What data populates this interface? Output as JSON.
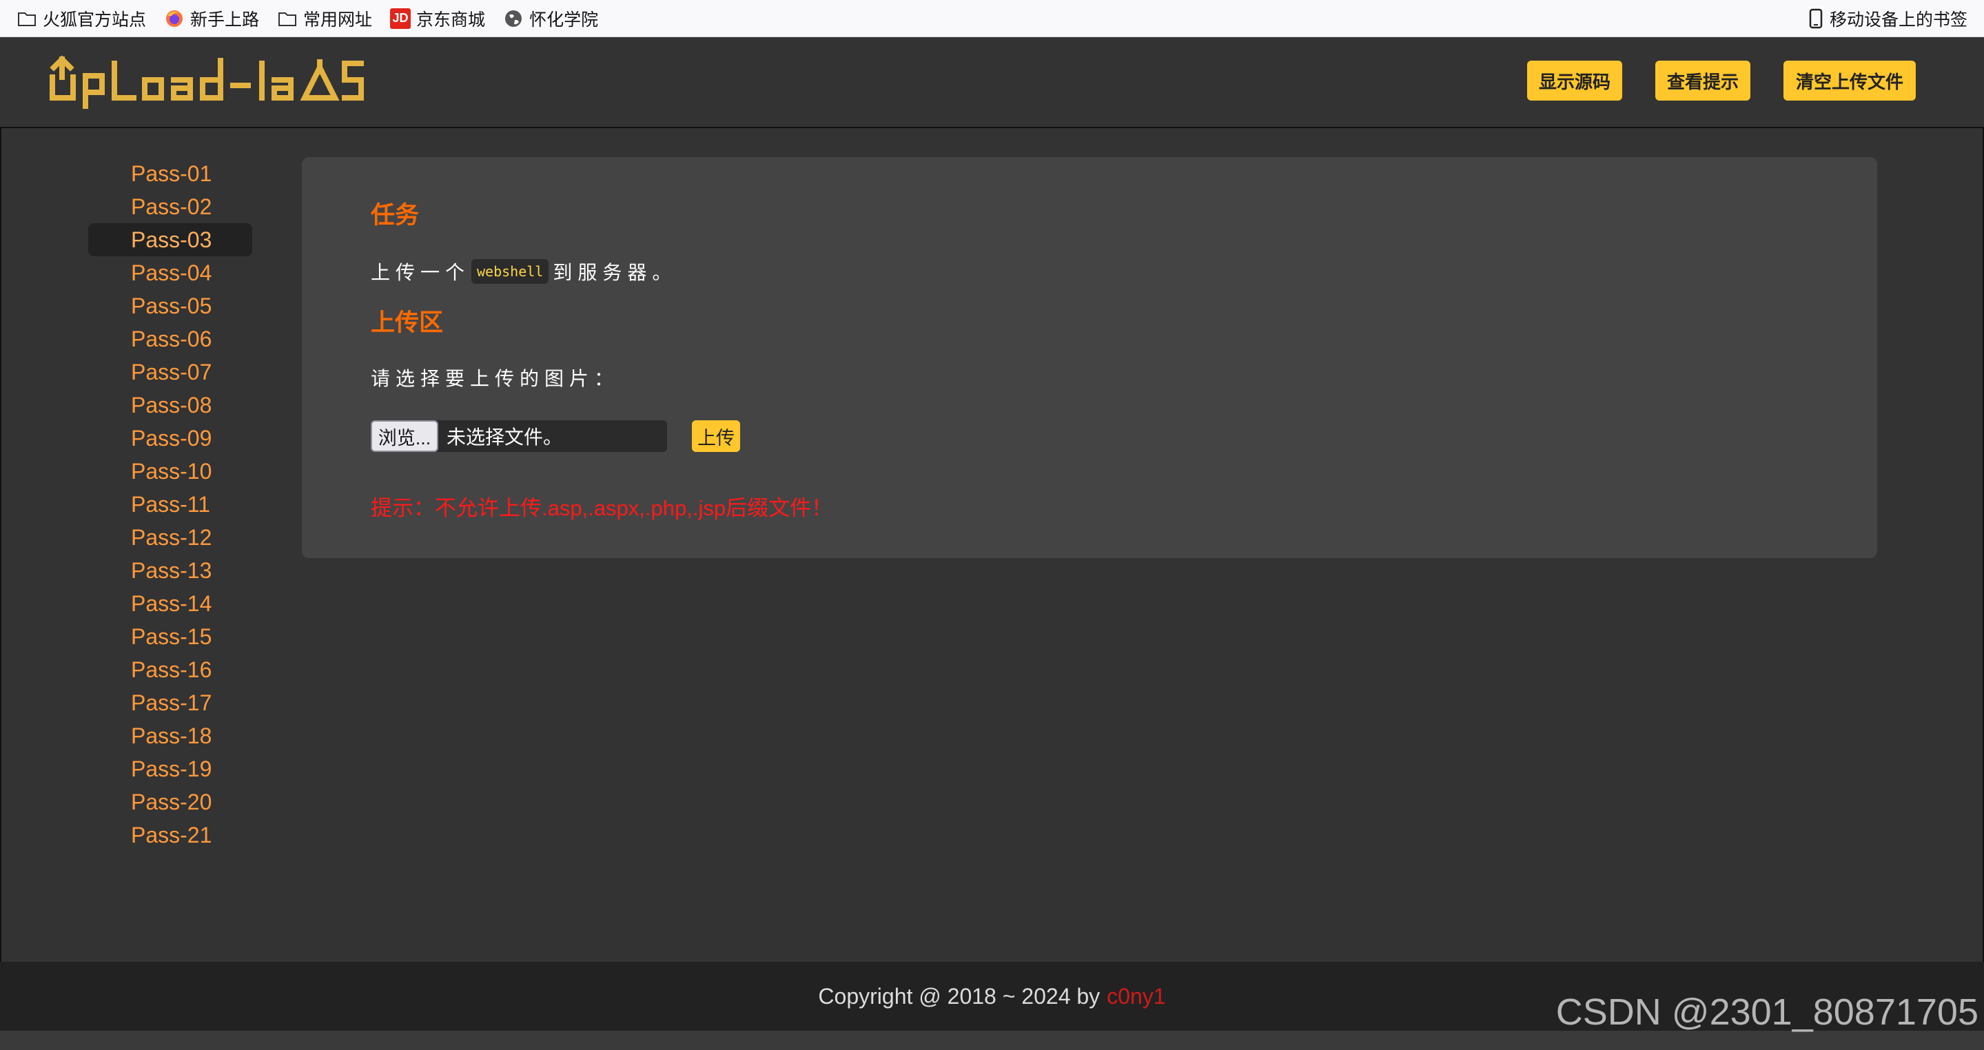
{
  "bookmarks": {
    "items": [
      {
        "label": "火狐官方站点",
        "icon": "folder-icon"
      },
      {
        "label": "新手上路",
        "icon": "firefox-icon"
      },
      {
        "label": "常用网址",
        "icon": "folder-icon"
      },
      {
        "label": "京东商城",
        "icon": "jd-icon"
      },
      {
        "label": "怀化学院",
        "icon": "globe-icon"
      }
    ],
    "right": {
      "label": "移动设备上的书签",
      "icon": "mobile-icon"
    },
    "jd_badge": "JD"
  },
  "header": {
    "logo_text": "Upload-labs",
    "buttons": {
      "show_source": "显示源码",
      "view_hint": "查看提示",
      "clear_uploads": "清空上传文件"
    },
    "button_color": "#ffc72c"
  },
  "sidebar": {
    "items": [
      "Pass-01",
      "Pass-02",
      "Pass-03",
      "Pass-04",
      "Pass-05",
      "Pass-06",
      "Pass-07",
      "Pass-08",
      "Pass-09",
      "Pass-10",
      "Pass-11",
      "Pass-12",
      "Pass-13",
      "Pass-14",
      "Pass-15",
      "Pass-16",
      "Pass-17",
      "Pass-18",
      "Pass-19",
      "Pass-20",
      "Pass-21"
    ],
    "active": "Pass-03",
    "link_color": "#ff9a3c"
  },
  "panel": {
    "task_title": "任务",
    "task_before": "上传一个",
    "task_code": "webshell",
    "task_after": "到服务器。",
    "upload_title": "上传区",
    "select_text": "请选择要上传的图片：",
    "browse_label": "浏览...",
    "file_status": "未选择文件。",
    "upload_label": "上传",
    "hint": "提示：不允许上传.asp,.aspx,.php,.jsp后缀文件！",
    "title_color": "#ff6a00",
    "hint_color": "#ff1a1a"
  },
  "footer": {
    "copyright": "Copyright @ 2018 ~ 2024 by",
    "author": "c0ny1"
  },
  "watermark": "CSDN @2301_80871705"
}
